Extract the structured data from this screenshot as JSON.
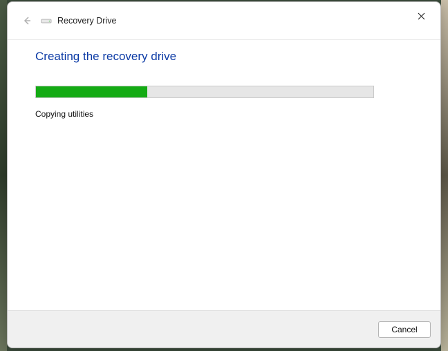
{
  "window": {
    "title": "Recovery Drive"
  },
  "main": {
    "heading": "Creating the recovery drive",
    "progress_percent": 33,
    "status": "Copying utilities"
  },
  "footer": {
    "cancel_label": "Cancel"
  },
  "colors": {
    "accent": "#0b3aa5",
    "progress": "#14ab14"
  }
}
